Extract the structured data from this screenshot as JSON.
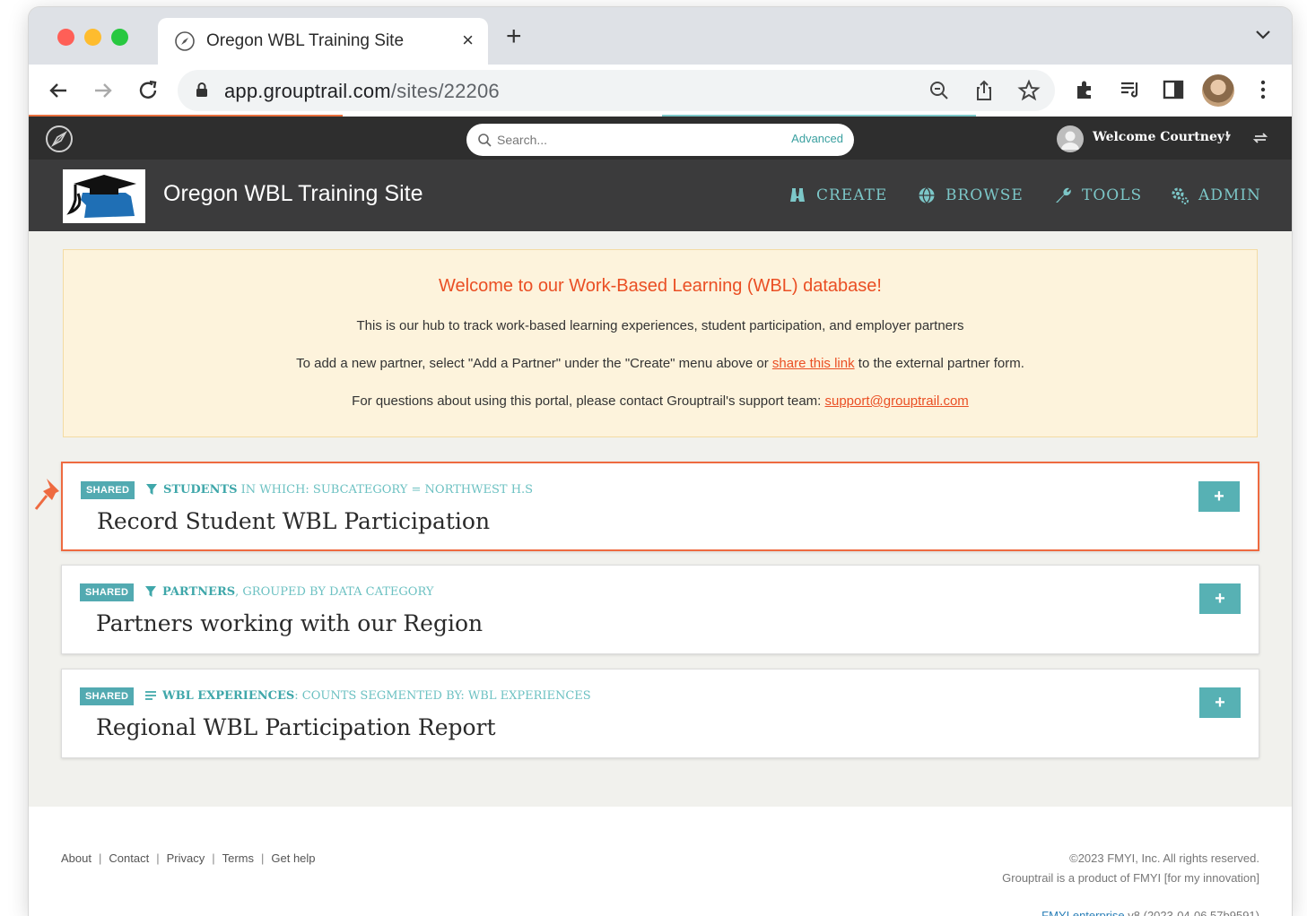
{
  "browser": {
    "tab_title": "Oregon WBL Training Site",
    "new_tab_symbol": "+",
    "close_symbol": "×",
    "url_host": "app.grouptrail.com",
    "url_path": "/sites/22206"
  },
  "appbar": {
    "search_placeholder": "Search...",
    "advanced_label": "Advanced",
    "welcome_text": "Welcome Courtney!",
    "caret": "▾"
  },
  "site": {
    "title": "Oregon WBL Training Site",
    "nav": [
      {
        "label": "CREATE",
        "icon": "binoculars-icon"
      },
      {
        "label": "BROWSE",
        "icon": "globe-icon"
      },
      {
        "label": "TOOLS",
        "icon": "wrench-icon"
      },
      {
        "label": "ADMIN",
        "icon": "gears-icon"
      }
    ]
  },
  "banner": {
    "title": "Welcome to our Work-Based Learning (WBL) database!",
    "line1": "This is our hub to track work-based learning experiences, student participation, and employer partners",
    "line2_before": "To add a new partner, select \"Add a Partner\" under the \"Create\" menu above or ",
    "line2_link": "share this link",
    "line2_after": " to the external partner form.",
    "line3_before": "For questions about using this portal, please contact Grouptrail's support team: ",
    "line3_link": "support@grouptrail.com"
  },
  "cards": [
    {
      "badge": "SHARED",
      "meta_main": "STUDENTS",
      "meta_rest": " IN WHICH: SUBCATEGORY = NORTHWEST H.S",
      "title": "Record Student WBL Participation",
      "icon": "filter-icon",
      "pinned": true,
      "button": "+"
    },
    {
      "badge": "SHARED",
      "meta_main": "PARTNERS",
      "meta_rest": ", GROUPED BY DATA CATEGORY",
      "title": "Partners working with our Region",
      "icon": "filter-icon",
      "pinned": false,
      "button": "+"
    },
    {
      "badge": "SHARED",
      "meta_main": "WBL EXPERIENCES",
      "meta_rest": ": COUNTS SEGMENTED BY: WBL EXPERIENCES",
      "title": "Regional WBL Participation Report",
      "icon": "list-icon",
      "pinned": false,
      "button": "+"
    }
  ],
  "footer": {
    "links": [
      "About",
      "Contact",
      "Privacy",
      "Terms",
      "Get help"
    ],
    "separator": "|",
    "copyright": "©2023 FMYI, Inc. All rights reserved.",
    "product_line": "Grouptrail is a product of FMYI [for my innovation]",
    "version_brand": "FMYI enterprise",
    "version_rest": " v8 (2023-04-06 57b9591)"
  },
  "colors": {
    "accent_teal": "#57b1b4",
    "accent_orange": "#ea4f24",
    "header_dark": "#3b3b3c",
    "banner_bg": "#fdf3dc"
  }
}
